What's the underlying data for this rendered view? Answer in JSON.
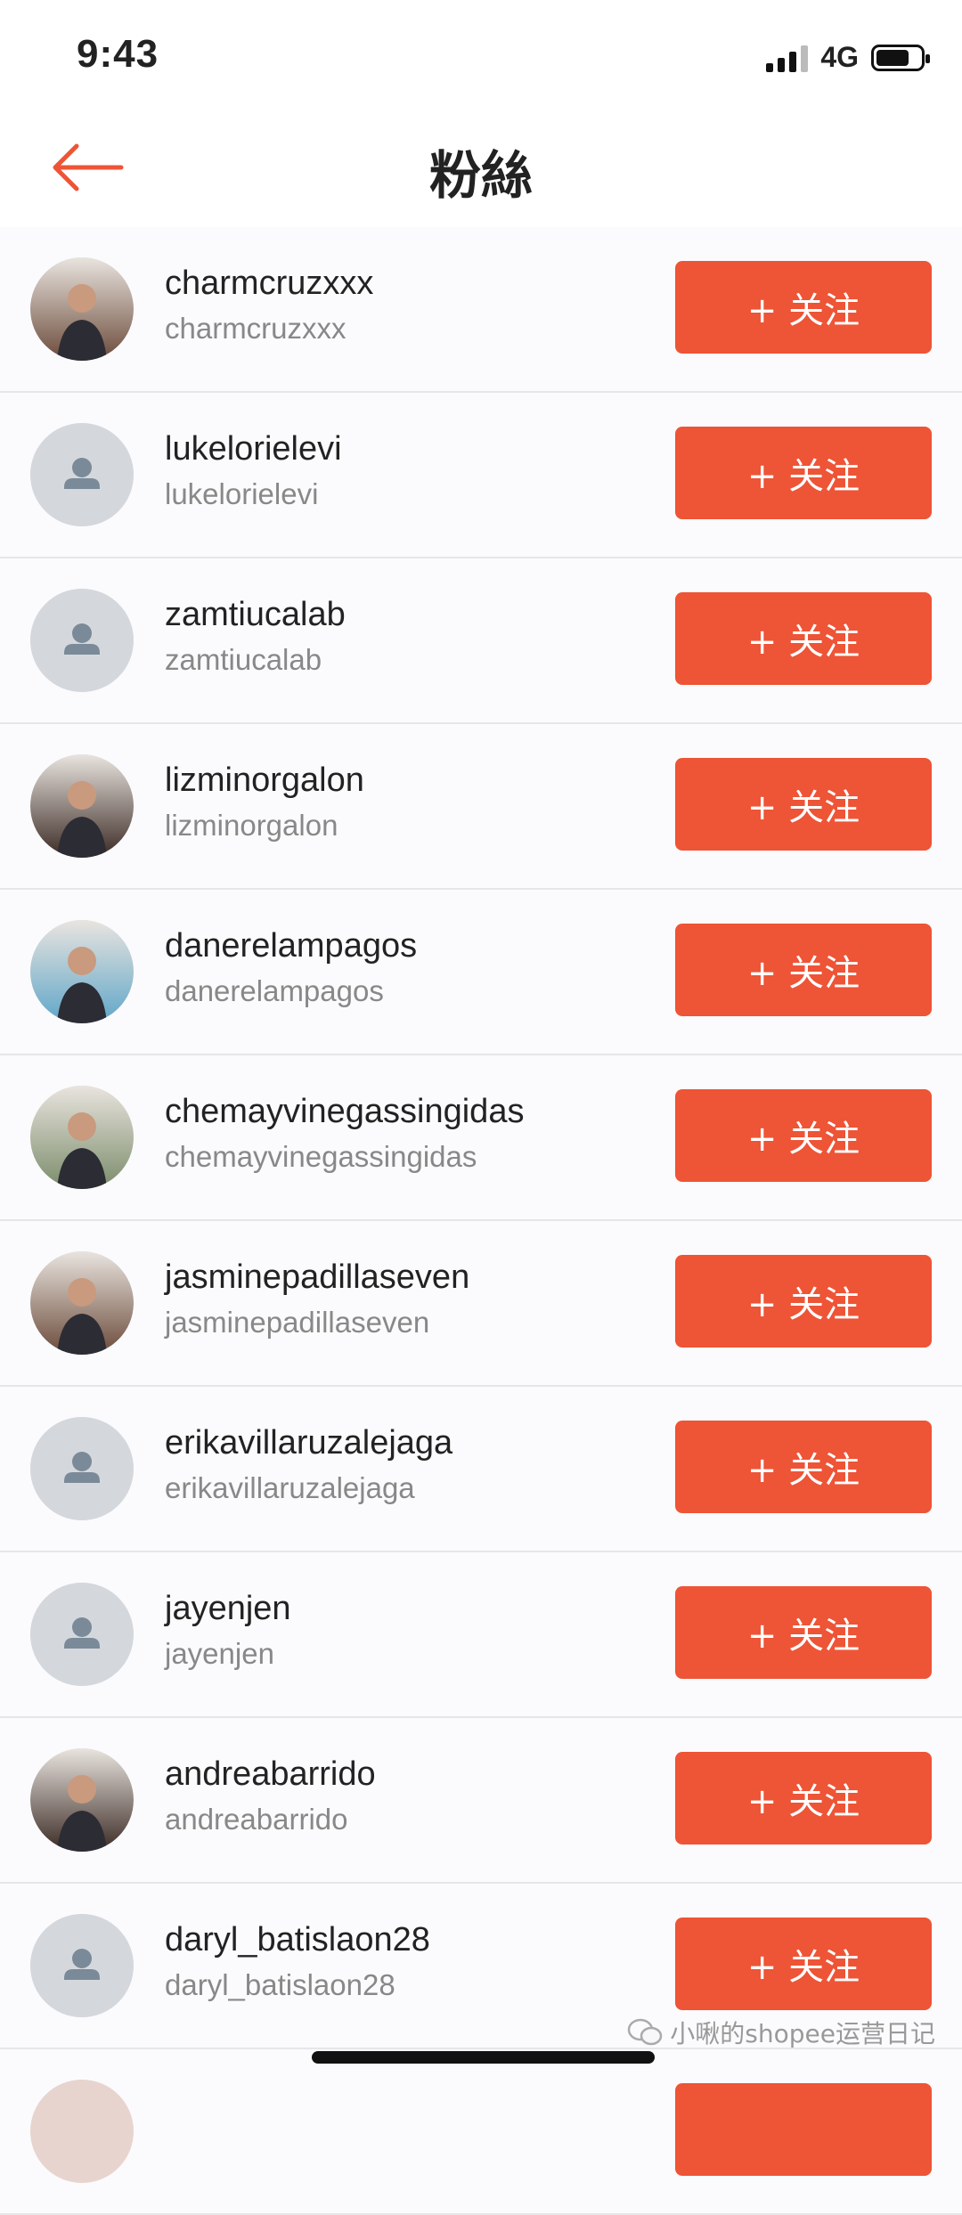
{
  "status_bar": {
    "time": "9:43",
    "network": "4G",
    "battery_level": 0.75
  },
  "header": {
    "title": "粉絲",
    "back_icon": "arrow-left-icon"
  },
  "colors": {
    "accent": "#ee5436",
    "avatar_placeholder": "#d4d8dd",
    "avatar_figure": "#7a8a98"
  },
  "followers": [
    {
      "display_name": "charmcruzxxx",
      "username": "charmcruzxxx",
      "avatar": "photo",
      "follow_label": "+ 关注"
    },
    {
      "display_name": "lukelorielevi",
      "username": "lukelorielevi",
      "avatar": "default",
      "follow_label": "+ 关注"
    },
    {
      "display_name": "zamtiucalab",
      "username": "zamtiucalab",
      "avatar": "default",
      "follow_label": "+ 关注"
    },
    {
      "display_name": "lizminorgalon",
      "username": "lizminorgalon",
      "avatar": "photo",
      "follow_label": "+ 关注"
    },
    {
      "display_name": "danerelampagos",
      "username": "danerelampagos",
      "avatar": "photo",
      "follow_label": "+ 关注"
    },
    {
      "display_name": "chemayvinegassingidas",
      "username": "chemayvinegassingidas",
      "avatar": "photo",
      "follow_label": "+ 关注"
    },
    {
      "display_name": "jasminepadillaseven",
      "username": "jasminepadillaseven",
      "avatar": "photo",
      "follow_label": "+ 关注"
    },
    {
      "display_name": "erikavillaruzalejaga",
      "username": "erikavillaruzalejaga",
      "avatar": "default",
      "follow_label": "+ 关注"
    },
    {
      "display_name": "jayenjen",
      "username": "jayenjen",
      "avatar": "default",
      "follow_label": "+ 关注"
    },
    {
      "display_name": "andreabarrido",
      "username": "andreabarrido",
      "avatar": "photo",
      "follow_label": "+ 关注"
    },
    {
      "display_name": "daryl_batislaon28",
      "username": "daryl_batislaon28",
      "avatar": "default",
      "follow_label": "+ 关注"
    }
  ],
  "watermark": "小啾的shopee运营日记"
}
